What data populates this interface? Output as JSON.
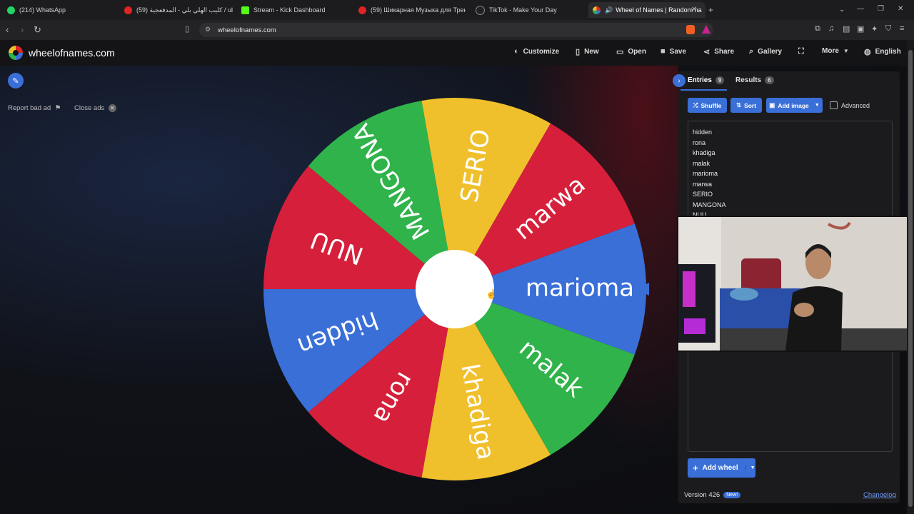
{
  "browser": {
    "tabs": [
      {
        "title": "(214) WhatsApp",
        "color": "#25d366"
      },
      {
        "title": "(59) كليب الهلي بلي - المدفعجية / ube",
        "color": "#e02424"
      },
      {
        "title": "Stream - Kick Dashboard",
        "color": "#53fc18"
      },
      {
        "title": "(59) Шикарная Музыка для Трени",
        "color": "#e02424"
      },
      {
        "title": "TikTok - Make Your Day",
        "color": "#222222"
      },
      {
        "title": "Wheel of Names | Random na",
        "color": "#3a6fd8"
      }
    ],
    "new_tab": "+",
    "url": "wheelofnames.com"
  },
  "header": {
    "site_title": "wheelofnames.com",
    "menu": [
      {
        "label": "Customize",
        "icon": "palette-icon"
      },
      {
        "label": "New",
        "icon": "file-icon"
      },
      {
        "label": "Open",
        "icon": "folder-icon"
      },
      {
        "label": "Save",
        "icon": "save-icon"
      },
      {
        "label": "Share",
        "icon": "share-icon"
      },
      {
        "label": "Gallery",
        "icon": "search-icon"
      },
      {
        "label": "",
        "icon": "fullscreen-icon"
      },
      {
        "label": "More",
        "icon": "chevron-down-icon"
      },
      {
        "label": "English",
        "icon": "globe-icon"
      }
    ]
  },
  "ads": {
    "report_bad_ad": "Report bad ad",
    "close_ads": "Close ads"
  },
  "wheel": {
    "segments": [
      {
        "label": "marioma",
        "color": "#3a6fd8"
      },
      {
        "label": "malak",
        "color": "#2fb34a"
      },
      {
        "label": "khadiga",
        "color": "#f0c02c"
      },
      {
        "label": "rona",
        "color": "#d61f3a"
      },
      {
        "label": "hidden",
        "color": "#3a6fd8"
      },
      {
        "label": "NUU",
        "color": "#d61f3a"
      },
      {
        "label": "MANGONA",
        "color": "#2fb34a"
      },
      {
        "label": "SERIO",
        "color": "#f0c02c"
      },
      {
        "label": "marwa",
        "color": "#d61f3a"
      }
    ],
    "pointer_color": "#3a6fd8"
  },
  "panel": {
    "entries_tab": "Entries",
    "entries_count": "9",
    "results_tab": "Results",
    "results_count": "6",
    "shuffle": "Shuffle",
    "sort": "Sort",
    "add_image": "Add image",
    "advanced": "Advanced",
    "entries": [
      "hidden",
      "rona",
      "khadiga",
      "malak",
      "marioma",
      "marwa",
      "SERIO",
      "MANGONA",
      "NUU"
    ],
    "add_wheel": "Add wheel",
    "version": "Version 426",
    "new_badge": "New!",
    "changelog": "Changelog"
  }
}
